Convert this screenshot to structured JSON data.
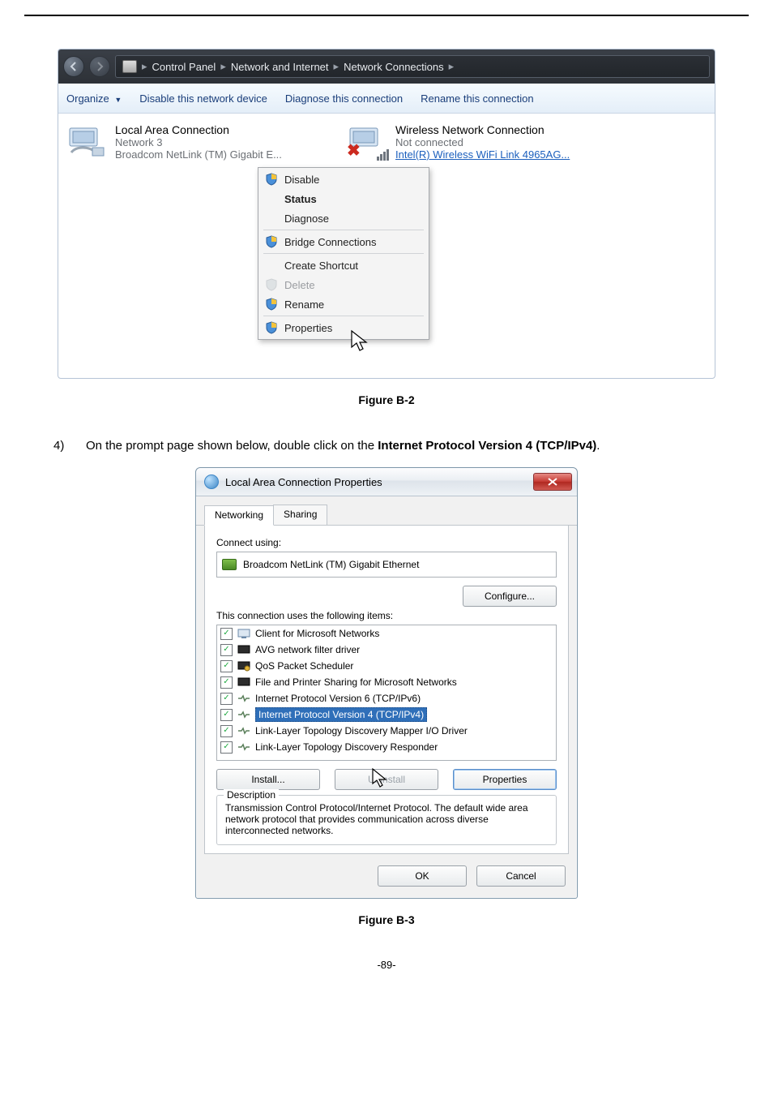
{
  "explorer": {
    "breadcrumb": [
      "Control Panel",
      "Network and Internet",
      "Network Connections"
    ],
    "commands": {
      "organize": "Organize",
      "disable": "Disable this network device",
      "diagnose": "Diagnose this connection",
      "rename": "Rename this connection"
    },
    "adapters": [
      {
        "name": "Local Area Connection",
        "status": "Network 3",
        "device": "Broadcom NetLink (TM) Gigabit E..."
      },
      {
        "name": "Wireless Network Connection",
        "status": "Not connected",
        "device": "Intel(R) Wireless WiFi Link 4965AG..."
      }
    ],
    "context_menu": {
      "disable": "Disable",
      "status": "Status",
      "diagnose": "Diagnose",
      "bridge": "Bridge Connections",
      "shortcut": "Create Shortcut",
      "delete": "Delete",
      "rename": "Rename",
      "properties": "Properties"
    }
  },
  "caption_b2": "Figure B-2",
  "step4": {
    "num": "4)",
    "text_before": "On the prompt page shown below, double click on the ",
    "bold": "Internet Protocol Version 4 (TCP/IPv4)",
    "text_after": "."
  },
  "dialog": {
    "title": "Local Area Connection Properties",
    "tabs": {
      "networking": "Networking",
      "sharing": "Sharing"
    },
    "connect_using_label": "Connect using:",
    "device": "Broadcom NetLink (TM) Gigabit Ethernet",
    "configure_btn": "Configure...",
    "uses_label": "This connection uses the following items:",
    "items": [
      "Client for Microsoft Networks",
      "AVG network filter driver",
      "QoS Packet Scheduler",
      "File and Printer Sharing for Microsoft Networks",
      "Internet Protocol Version 6 (TCP/IPv6)",
      "Internet Protocol Version 4 (TCP/IPv4)",
      "Link-Layer Topology Discovery Mapper I/O Driver",
      "Link-Layer Topology Discovery Responder"
    ],
    "buttons": {
      "install": "Install...",
      "uninstall": "Uninstall",
      "properties": "Properties"
    },
    "description": {
      "legend": "Description",
      "text": "Transmission Control Protocol/Internet Protocol. The default wide area network protocol that provides communication across diverse interconnected networks."
    },
    "footer": {
      "ok": "OK",
      "cancel": "Cancel"
    }
  },
  "caption_b3": "Figure B-3",
  "page_number": "-89-"
}
